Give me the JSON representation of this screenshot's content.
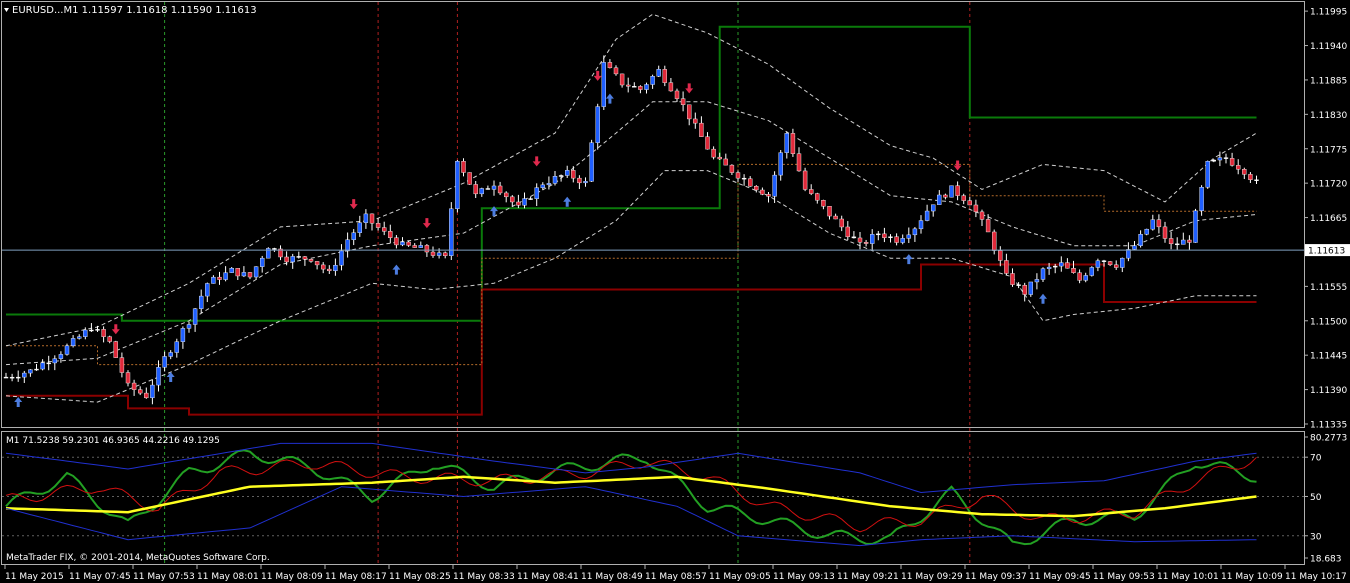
{
  "header": {
    "symbol_line": "EURUSD...M1  1.11597 1.11618 1.11590 1.11613"
  },
  "sub_header": {
    "indicator_line": "M1  71.5238 59.2301 46.9365 44.2216 49.1295"
  },
  "footer": {
    "copyright": "MetaTrader FIX, © 2001-2014, MetaQuotes Software Corp."
  },
  "colors": {
    "background": "#000000",
    "grid": "#808080",
    "bull_candle": "#1f5fff",
    "bear_candle": "#e0293a",
    "doji": "#ffffff",
    "band_line": "#d0d0d0",
    "green_channel": "#0a7a0a",
    "red_channel": "#8b0000",
    "orange_dotted": "#b36b2a",
    "sell_arrow": "#e0294d",
    "buy_arrow": "#4d7de0",
    "osc_green": "#23a023",
    "osc_red": "#d01010",
    "osc_yellow": "#ffff20",
    "osc_blue": "#2030d0",
    "price_line": "#7f9fbf"
  },
  "chart_data": [
    {
      "type": "candlestick",
      "title": "EURUSD...M1  1.11597 1.11618 1.11590 1.11613",
      "ylim": [
        1.11335,
        1.12
      ],
      "y_ticks": [
        "1.11995",
        "1.11940",
        "1.11885",
        "1.11830",
        "1.11775",
        "1.11720",
        "1.11665",
        "1.11613",
        "1.11555",
        "1.11500",
        "1.11445",
        "1.11390",
        "1.11335"
      ],
      "current_price": 1.11613,
      "x_tick_labels": [
        "11 May 2015",
        "11 May 07:45",
        "11 May 07:53",
        "11 May 08:01",
        "11 May 08:09",
        "11 May 08:17",
        "11 May 08:25",
        "11 May 08:33",
        "11 May 08:41",
        "11 May 08:49",
        "11 May 08:57",
        "11 May 09:05",
        "11 May 09:13",
        "11 May 09:21",
        "11 May 09:29",
        "11 May 09:37",
        "11 May 09:45",
        "11 May 09:53",
        "11 May 10:01",
        "11 May 10:09",
        "11 May 10:17"
      ],
      "close_anchors": [
        [
          0,
          1.1141
        ],
        [
          4,
          1.1142
        ],
        [
          9,
          1.1145
        ],
        [
          14,
          1.1149
        ],
        [
          17,
          1.11465
        ],
        [
          20,
          1.11395
        ],
        [
          23,
          1.1138
        ],
        [
          26,
          1.1144
        ],
        [
          30,
          1.115
        ],
        [
          33,
          1.1156
        ],
        [
          37,
          1.1158
        ],
        [
          40,
          1.1157
        ],
        [
          43,
          1.1162
        ],
        [
          46,
          1.116
        ],
        [
          50,
          1.116
        ],
        [
          53,
          1.11575
        ],
        [
          56,
          1.1163
        ],
        [
          59,
          1.11665
        ],
        [
          62,
          1.1164
        ],
        [
          65,
          1.1162
        ],
        [
          68,
          1.11615
        ],
        [
          72,
          1.116
        ],
        [
          74,
          1.1176
        ],
        [
          77,
          1.117
        ],
        [
          80,
          1.1172
        ],
        [
          84,
          1.1168
        ],
        [
          88,
          1.1172
        ],
        [
          92,
          1.11735
        ],
        [
          95,
          1.1172
        ],
        [
          98,
          1.1191
        ],
        [
          101,
          1.1188
        ],
        [
          104,
          1.1187
        ],
        [
          107,
          1.119
        ],
        [
          110,
          1.1186
        ],
        [
          113,
          1.1181
        ],
        [
          116,
          1.1176
        ],
        [
          119,
          1.1174
        ],
        [
          122,
          1.1172
        ],
        [
          125,
          1.117
        ],
        [
          128,
          1.118
        ],
        [
          131,
          1.1171
        ],
        [
          134,
          1.1168
        ],
        [
          137,
          1.1165
        ],
        [
          140,
          1.1162
        ],
        [
          143,
          1.1164
        ],
        [
          146,
          1.1163
        ],
        [
          149,
          1.1165
        ],
        [
          152,
          1.1169
        ],
        [
          155,
          1.1171
        ],
        [
          158,
          1.1169
        ],
        [
          161,
          1.1164
        ],
        [
          164,
          1.1157
        ],
        [
          167,
          1.11545
        ],
        [
          170,
          1.1158
        ],
        [
          173,
          1.1159
        ],
        [
          176,
          1.11565
        ],
        [
          179,
          1.116
        ],
        [
          182,
          1.1159
        ],
        [
          185,
          1.1162
        ],
        [
          188,
          1.1166
        ],
        [
          191,
          1.1162
        ],
        [
          194,
          1.1163
        ],
        [
          197,
          1.1175
        ],
        [
          200,
          1.1176
        ],
        [
          203,
          1.1174
        ],
        [
          205,
          1.1172
        ]
      ],
      "bollinger_upper_anchors": [
        [
          0,
          1.1146
        ],
        [
          15,
          1.1149
        ],
        [
          30,
          1.1156
        ],
        [
          45,
          1.1165
        ],
        [
          60,
          1.1166
        ],
        [
          75,
          1.1172
        ],
        [
          90,
          1.118
        ],
        [
          100,
          1.1195
        ],
        [
          106,
          1.1199
        ],
        [
          115,
          1.1196
        ],
        [
          125,
          1.1191
        ],
        [
          135,
          1.1184
        ],
        [
          145,
          1.1178
        ],
        [
          152,
          1.1176
        ],
        [
          160,
          1.1171
        ],
        [
          170,
          1.1175
        ],
        [
          180,
          1.1174
        ],
        [
          190,
          1.1169
        ],
        [
          198,
          1.1176
        ],
        [
          205,
          1.118
        ]
      ],
      "bollinger_mid_anchors": [
        [
          0,
          1.1143
        ],
        [
          15,
          1.1144
        ],
        [
          30,
          1.115
        ],
        [
          45,
          1.1159
        ],
        [
          60,
          1.1162
        ],
        [
          75,
          1.1164
        ],
        [
          90,
          1.1172
        ],
        [
          100,
          1.118
        ],
        [
          106,
          1.1185
        ],
        [
          115,
          1.1185
        ],
        [
          125,
          1.1182
        ],
        [
          135,
          1.1176
        ],
        [
          145,
          1.117
        ],
        [
          155,
          1.1169
        ],
        [
          165,
          1.1165
        ],
        [
          175,
          1.1162
        ],
        [
          185,
          1.1162
        ],
        [
          195,
          1.1166
        ],
        [
          205,
          1.1167
        ]
      ],
      "bollinger_lower_anchors": [
        [
          0,
          1.1138
        ],
        [
          15,
          1.1137
        ],
        [
          30,
          1.1143
        ],
        [
          45,
          1.115
        ],
        [
          60,
          1.1156
        ],
        [
          70,
          1.1155
        ],
        [
          80,
          1.1156
        ],
        [
          90,
          1.116
        ],
        [
          100,
          1.1166
        ],
        [
          108,
          1.1174
        ],
        [
          115,
          1.1174
        ],
        [
          125,
          1.117
        ],
        [
          135,
          1.1164
        ],
        [
          145,
          1.116
        ],
        [
          155,
          1.116
        ],
        [
          165,
          1.1157
        ],
        [
          170,
          1.115
        ],
        [
          175,
          1.1151
        ],
        [
          185,
          1.1152
        ],
        [
          195,
          1.1154
        ],
        [
          205,
          1.1154
        ]
      ],
      "green_channel_steps": [
        [
          0,
          1.1151
        ],
        [
          19,
          1.1151
        ],
        [
          19,
          1.115
        ],
        [
          78,
          1.115
        ],
        [
          78,
          1.1168
        ],
        [
          117,
          1.1168
        ],
        [
          117,
          1.1197
        ],
        [
          155,
          1.1197
        ],
        [
          155,
          1.1197
        ],
        [
          158,
          1.1197
        ],
        [
          158,
          1.11825
        ],
        [
          205,
          1.11825
        ]
      ],
      "red_channel_steps": [
        [
          0,
          1.1138
        ],
        [
          20,
          1.1138
        ],
        [
          20,
          1.1136
        ],
        [
          30,
          1.1136
        ],
        [
          30,
          1.1135
        ],
        [
          78,
          1.1135
        ],
        [
          78,
          1.1155
        ],
        [
          150,
          1.1155
        ],
        [
          150,
          1.1159
        ],
        [
          180,
          1.1159
        ],
        [
          180,
          1.1153
        ],
        [
          205,
          1.1153
        ]
      ],
      "sell_arrow_bars": [
        18,
        57,
        69,
        87,
        97,
        112,
        156
      ],
      "buy_arrow_bars": [
        2,
        27,
        64,
        80,
        92,
        99,
        148,
        170
      ]
    },
    {
      "type": "line",
      "title": "M1  71.5238 59.2301 46.9365 44.2216 49.1295",
      "ylim": [
        18.683,
        80.2773
      ],
      "y_tick_labels": [
        "80.2773",
        "70",
        "50",
        "30",
        "18.683"
      ],
      "levels": [
        70,
        50,
        30
      ],
      "series": [
        {
          "values_anchors": [
            [
              0,
              45
            ],
            [
              10,
              60
            ],
            [
              20,
              35
            ],
            [
              30,
              62
            ],
            [
              40,
              72
            ],
            [
              50,
              65
            ],
            [
              60,
              50
            ],
            [
              70,
              67
            ],
            [
              80,
              55
            ],
            [
              90,
              63
            ],
            [
              100,
              68
            ],
            [
              105,
              70
            ],
            [
              115,
              45
            ],
            [
              125,
              38
            ],
            [
              135,
              30
            ],
            [
              145,
              28
            ],
            [
              155,
              52
            ],
            [
              165,
              25
            ],
            [
              175,
              38
            ],
            [
              185,
              40
            ],
            [
              195,
              68
            ],
            [
              205,
              60
            ]
          ],
          "color_key": "osc_green"
        },
        {
          "values_anchors": [
            [
              0,
              48
            ],
            [
              15,
              55
            ],
            [
              25,
              44
            ],
            [
              35,
              62
            ],
            [
              50,
              67
            ],
            [
              65,
              60
            ],
            [
              80,
              58
            ],
            [
              95,
              62
            ],
            [
              105,
              68
            ],
            [
              115,
              60
            ],
            [
              125,
              45
            ],
            [
              140,
              35
            ],
            [
              150,
              38
            ],
            [
              160,
              50
            ],
            [
              170,
              38
            ],
            [
              185,
              42
            ],
            [
              195,
              58
            ],
            [
              205,
              70
            ]
          ],
          "color_key": "osc_red"
        },
        {
          "values_anchors": [
            [
              0,
              44
            ],
            [
              20,
              42
            ],
            [
              40,
              55
            ],
            [
              60,
              57
            ],
            [
              75,
              60
            ],
            [
              90,
              57
            ],
            [
              110,
              60
            ],
            [
              125,
              54
            ],
            [
              145,
              45
            ],
            [
              160,
              41
            ],
            [
              175,
              40
            ],
            [
              190,
              44
            ],
            [
              205,
              50
            ]
          ],
          "color_key": "osc_yellow"
        },
        {
          "values_anchors": [
            [
              0,
              72
            ],
            [
              20,
              64
            ],
            [
              45,
              77
            ],
            [
              60,
              77
            ],
            [
              80,
              68
            ],
            [
              95,
              62
            ],
            [
              105,
              65
            ],
            [
              120,
              72
            ],
            [
              140,
              62
            ],
            [
              150,
              52
            ],
            [
              165,
              56
            ],
            [
              180,
              58
            ],
            [
              195,
              68
            ],
            [
              205,
              72
            ]
          ],
          "color_key": "osc_blue"
        },
        {
          "values_anchors": [
            [
              0,
              44
            ],
            [
              20,
              28
            ],
            [
              40,
              34
            ],
            [
              55,
              55
            ],
            [
              75,
              50
            ],
            [
              95,
              55
            ],
            [
              110,
              45
            ],
            [
              120,
              30
            ],
            [
              140,
              25
            ],
            [
              150,
              28
            ],
            [
              165,
              30
            ],
            [
              185,
              27
            ],
            [
              205,
              28
            ]
          ],
          "color_key": "osc_blue"
        }
      ]
    }
  ]
}
